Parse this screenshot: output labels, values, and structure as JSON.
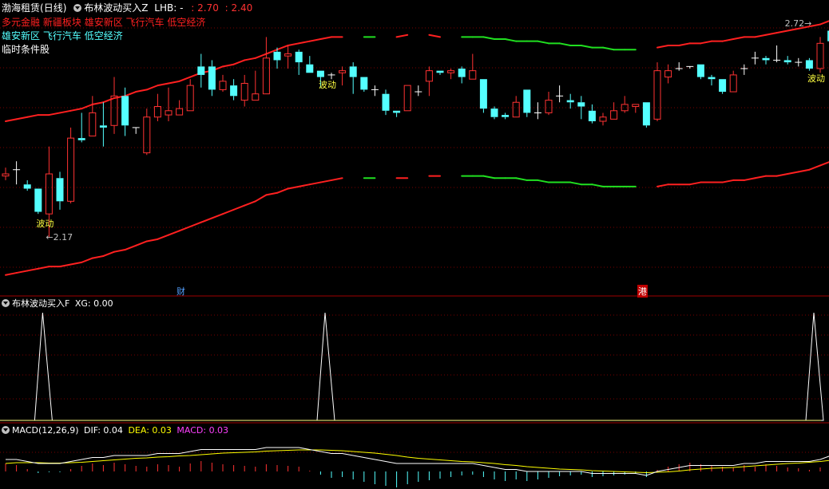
{
  "header": {
    "stock_name": "渤海租赁",
    "period": "(日线)",
    "indicator_main": "布林波动买入Z",
    "lhb_label": "LHB: -",
    "value1": ": 2.70",
    "value2": ": 2.40"
  },
  "concepts": {
    "line1": [
      "多元金融",
      "新疆板块",
      "雄安新区",
      "飞行汽车",
      "低空经济"
    ],
    "line2": [
      "雄安新区",
      "飞行汽车",
      "低空经济"
    ],
    "line3": "临时条件股"
  },
  "annotations": {
    "high_price": "2.72",
    "low_price": "2.17",
    "wave_label": "波动",
    "marker_cai": "财",
    "marker_gang": "港"
  },
  "panel2": {
    "name": "布林波动买入F",
    "xg_label": "XG: 0.00"
  },
  "panel3": {
    "name": "MACD(12,26,9)",
    "dif": "DIF: 0.04",
    "dea": "DEA: 0.03",
    "macd": "MACD: 0.03"
  },
  "colors": {
    "up": "#ff3232",
    "down": "#54ffff",
    "band_red": "#ff2020",
    "band_green": "#20e020",
    "grid": "#7a0000",
    "dif": "#ffffff",
    "dea": "#ffff00",
    "macd_text": "#ff40ff"
  },
  "chart_data": {
    "type": "candlestick",
    "ohlc": [
      [
        2.46,
        2.47,
        2.5,
        2.44
      ],
      [
        2.49,
        2.49,
        2.53,
        2.42
      ],
      [
        2.42,
        2.4,
        2.44,
        2.39
      ],
      [
        2.4,
        2.29,
        2.4,
        2.28
      ],
      [
        2.28,
        2.47,
        2.6,
        2.17
      ],
      [
        2.45,
        2.34,
        2.48,
        2.3
      ],
      [
        2.34,
        2.64,
        2.69,
        2.33
      ],
      [
        2.64,
        2.63,
        2.76,
        2.62
      ],
      [
        2.65,
        2.76,
        2.84,
        2.65
      ],
      [
        2.7,
        2.69,
        2.81,
        2.6
      ],
      [
        2.7,
        2.84,
        2.93,
        2.66
      ],
      [
        2.84,
        2.7,
        2.88,
        2.65
      ],
      [
        2.69,
        2.69,
        2.69,
        2.66
      ],
      [
        2.57,
        2.74,
        2.78,
        2.56
      ],
      [
        2.74,
        2.79,
        2.85,
        2.72
      ],
      [
        2.75,
        2.77,
        2.88,
        2.72
      ],
      [
        2.75,
        2.78,
        2.82,
        2.75
      ],
      [
        2.77,
        2.89,
        2.92,
        2.77
      ],
      [
        2.98,
        2.94,
        3.04,
        2.88
      ],
      [
        2.98,
        2.87,
        3.01,
        2.84
      ],
      [
        2.87,
        2.91,
        2.94,
        2.86
      ],
      [
        2.89,
        2.84,
        2.92,
        2.82
      ],
      [
        2.82,
        2.9,
        2.94,
        2.79
      ],
      [
        2.82,
        2.85,
        2.96,
        2.82
      ],
      [
        2.85,
        3.02,
        3.12,
        2.85
      ],
      [
        3.05,
        3.01,
        3.07,
        2.97
      ],
      [
        3.03,
        3.04,
        3.08,
        2.97
      ],
      [
        3.05,
        3.0,
        3.06,
        2.94
      ],
      [
        2.99,
        2.95,
        3.03,
        2.95
      ],
      [
        2.96,
        2.93,
        2.96,
        2.88
      ],
      [
        2.94,
        2.94,
        2.95,
        2.92
      ],
      [
        2.95,
        2.96,
        2.98,
        2.89
      ],
      [
        2.98,
        2.93,
        3.0,
        2.85
      ],
      [
        2.93,
        2.87,
        2.93,
        2.86
      ],
      [
        2.87,
        2.87,
        2.89,
        2.84
      ],
      [
        2.85,
        2.77,
        2.87,
        2.75
      ],
      [
        2.77,
        2.76,
        2.77,
        2.74
      ],
      [
        2.77,
        2.89,
        2.89,
        2.77
      ],
      [
        2.86,
        2.86,
        2.89,
        2.84
      ],
      [
        2.91,
        2.96,
        2.98,
        2.84
      ],
      [
        2.96,
        2.95,
        2.96,
        2.94
      ],
      [
        2.95,
        2.96,
        2.97,
        2.92
      ],
      [
        2.97,
        2.93,
        2.98,
        2.9
      ],
      [
        2.92,
        2.96,
        3.04,
        2.92
      ],
      [
        2.92,
        2.78,
        2.92,
        2.76
      ],
      [
        2.78,
        2.74,
        2.79,
        2.73
      ],
      [
        2.75,
        2.74,
        2.76,
        2.73
      ],
      [
        2.74,
        2.81,
        2.84,
        2.74
      ],
      [
        2.87,
        2.76,
        2.87,
        2.74
      ],
      [
        2.76,
        2.76,
        2.81,
        2.73
      ],
      [
        2.76,
        2.82,
        2.86,
        2.75
      ],
      [
        2.84,
        2.84,
        2.89,
        2.81
      ],
      [
        2.82,
        2.81,
        2.85,
        2.78
      ],
      [
        2.81,
        2.79,
        2.84,
        2.73
      ],
      [
        2.77,
        2.72,
        2.8,
        2.71
      ],
      [
        2.72,
        2.74,
        2.76,
        2.7
      ],
      [
        2.73,
        2.77,
        2.81,
        2.73
      ],
      [
        2.77,
        2.8,
        2.84,
        2.76
      ],
      [
        2.79,
        2.8,
        2.8,
        2.76
      ],
      [
        2.81,
        2.7,
        2.81,
        2.69
      ],
      [
        2.73,
        2.96,
        3.0,
        2.72
      ],
      [
        2.93,
        2.96,
        2.99,
        2.9
      ],
      [
        2.97,
        2.97,
        3.0,
        2.96
      ],
      [
        2.98,
        2.98,
        2.98,
        2.97
      ],
      [
        2.99,
        2.93,
        2.99,
        2.92
      ],
      [
        2.93,
        2.92,
        2.94,
        2.89
      ],
      [
        2.92,
        2.86,
        2.92,
        2.85
      ],
      [
        2.86,
        2.94,
        2.96,
        2.86
      ],
      [
        2.97,
        2.97,
        2.99,
        2.94
      ],
      [
        3.02,
        3.02,
        3.05,
        2.99
      ],
      [
        3.02,
        3.01,
        3.03,
        2.99
      ],
      [
        3.01,
        3.01,
        3.08,
        3.0
      ],
      [
        3.01,
        3.0,
        3.03,
        2.99
      ],
      [
        3.0,
        3.0,
        3.02,
        2.98
      ],
      [
        3.01,
        2.97,
        3.02,
        2.96
      ],
      [
        2.97,
        3.09,
        3.12,
        2.95
      ],
      [
        3.15,
        3.1,
        3.17,
        3.08
      ]
    ],
    "boll_upper": [
      2.72,
      2.73,
      2.74,
      2.75,
      2.75,
      2.76,
      2.77,
      2.78,
      2.8,
      2.81,
      2.83,
      2.84,
      2.86,
      2.87,
      2.89,
      2.9,
      2.91,
      2.93,
      2.95,
      2.96,
      2.98,
      2.99,
      3.01,
      3.02,
      3.04,
      3.06,
      3.08,
      3.09,
      3.1,
      3.11,
      3.12,
      3.12,
      null,
      3.12,
      3.12,
      null,
      3.12,
      3.13,
      null,
      3.13,
      3.12,
      null,
      3.12,
      3.12,
      3.12,
      3.11,
      3.11,
      3.1,
      3.1,
      3.1,
      3.09,
      3.09,
      3.08,
      3.08,
      3.07,
      3.07,
      3.06,
      3.06,
      3.06,
      null,
      3.07,
      3.08,
      3.08,
      3.09,
      3.09,
      3.1,
      3.1,
      3.11,
      3.12,
      3.12,
      3.13,
      3.14,
      3.15,
      3.16,
      3.17,
      3.18,
      3.2
    ],
    "boll_lower": [
      1.99,
      2.0,
      2.01,
      2.02,
      2.03,
      2.03,
      2.04,
      2.05,
      2.07,
      2.08,
      2.1,
      2.11,
      2.13,
      2.15,
      2.16,
      2.18,
      2.2,
      2.22,
      2.24,
      2.26,
      2.28,
      2.3,
      2.32,
      2.34,
      2.37,
      2.38,
      2.4,
      2.41,
      2.42,
      2.43,
      2.44,
      2.45,
      null,
      2.45,
      2.45,
      null,
      2.45,
      2.45,
      null,
      2.46,
      2.46,
      null,
      2.46,
      2.46,
      2.46,
      2.45,
      2.45,
      2.45,
      2.44,
      2.44,
      2.43,
      2.43,
      2.43,
      2.42,
      2.42,
      2.41,
      2.41,
      2.41,
      2.41,
      null,
      2.41,
      2.42,
      2.42,
      2.42,
      2.43,
      2.43,
      2.43,
      2.44,
      2.44,
      2.45,
      2.46,
      2.46,
      2.47,
      2.48,
      2.49,
      2.51,
      2.53
    ],
    "band_color_segments": [
      "red",
      "red",
      "red",
      "red",
      "red",
      "red",
      "red",
      "red",
      "red",
      "red",
      "red",
      "red",
      "red",
      "red",
      "red",
      "red",
      "red",
      "red",
      "red",
      "red",
      "red",
      "red",
      "red",
      "red",
      "red",
      "red",
      "red",
      "red",
      "red",
      "red",
      "red",
      "red",
      "red",
      "green",
      "green",
      "green",
      "red",
      "red",
      "red",
      "red",
      "green",
      "green",
      "green",
      "green",
      "green",
      "green",
      "green",
      "green",
      "green",
      "green",
      "green",
      "green",
      "green",
      "green",
      "green",
      "green",
      "green",
      "green",
      "green",
      "red",
      "red",
      "red",
      "red",
      "red",
      "red",
      "red",
      "red",
      "red",
      "red",
      "red",
      "red",
      "red",
      "red",
      "red",
      "red",
      "red",
      "red"
    ],
    "wave_signals": [
      4,
      30,
      75
    ],
    "xg_signals": [
      4,
      30,
      75
    ],
    "dif": [
      0.03,
      0.03,
      0.025,
      0.02,
      0.02,
      0.02,
      0.025,
      0.03,
      0.035,
      0.035,
      0.04,
      0.04,
      0.04,
      0.04,
      0.045,
      0.045,
      0.045,
      0.05,
      0.055,
      0.055,
      0.055,
      0.055,
      0.055,
      0.055,
      0.06,
      0.06,
      0.06,
      0.06,
      0.055,
      0.05,
      0.045,
      0.045,
      0.04,
      0.035,
      0.03,
      0.025,
      0.02,
      0.02,
      0.02,
      0.02,
      0.02,
      0.02,
      0.02,
      0.02,
      0.015,
      0.01,
      0.005,
      0.005,
      0.0,
      0.0,
      0.0,
      0.0,
      0.0,
      0.0,
      -0.005,
      -0.005,
      -0.005,
      -0.005,
      -0.005,
      -0.01,
      0.0,
      0.005,
      0.01,
      0.015,
      0.015,
      0.015,
      0.015,
      0.015,
      0.02,
      0.02,
      0.025,
      0.025,
      0.025,
      0.025,
      0.025,
      0.03,
      0.04
    ],
    "dea": [
      0.02,
      0.022,
      0.022,
      0.022,
      0.021,
      0.021,
      0.022,
      0.023,
      0.025,
      0.027,
      0.029,
      0.031,
      0.033,
      0.034,
      0.036,
      0.037,
      0.039,
      0.04,
      0.042,
      0.044,
      0.046,
      0.047,
      0.048,
      0.049,
      0.051,
      0.052,
      0.053,
      0.054,
      0.054,
      0.054,
      0.053,
      0.052,
      0.05,
      0.048,
      0.046,
      0.043,
      0.04,
      0.036,
      0.033,
      0.031,
      0.029,
      0.027,
      0.025,
      0.024,
      0.022,
      0.02,
      0.017,
      0.015,
      0.012,
      0.01,
      0.008,
      0.006,
      0.005,
      0.004,
      0.002,
      0.001,
      0.0,
      -0.001,
      -0.002,
      -0.003,
      -0.002,
      -0.001,
      0.001,
      0.004,
      0.006,
      0.008,
      0.009,
      0.01,
      0.012,
      0.014,
      0.016,
      0.018,
      0.02,
      0.021,
      0.023,
      0.025,
      0.028
    ],
    "macd": [
      0.02,
      0.016,
      0.006,
      -0.004,
      -0.002,
      -0.002,
      0.006,
      0.014,
      0.02,
      0.016,
      0.022,
      0.018,
      0.014,
      0.012,
      0.018,
      0.016,
      0.012,
      0.02,
      0.026,
      0.022,
      0.018,
      0.016,
      0.014,
      0.012,
      0.018,
      0.016,
      0.014,
      0.012,
      0.002,
      -0.008,
      -0.016,
      -0.014,
      -0.02,
      -0.026,
      -0.032,
      -0.036,
      -0.04,
      -0.032,
      -0.026,
      -0.022,
      -0.018,
      -0.014,
      -0.01,
      -0.008,
      -0.014,
      -0.02,
      -0.024,
      -0.02,
      -0.024,
      -0.02,
      -0.016,
      -0.012,
      -0.01,
      -0.008,
      -0.014,
      -0.012,
      -0.01,
      -0.008,
      -0.006,
      -0.014,
      0.004,
      0.012,
      0.018,
      0.022,
      0.018,
      0.014,
      0.012,
      0.01,
      0.016,
      0.012,
      0.018,
      0.014,
      0.01,
      0.008,
      0.004,
      0.01,
      0.024
    ]
  }
}
